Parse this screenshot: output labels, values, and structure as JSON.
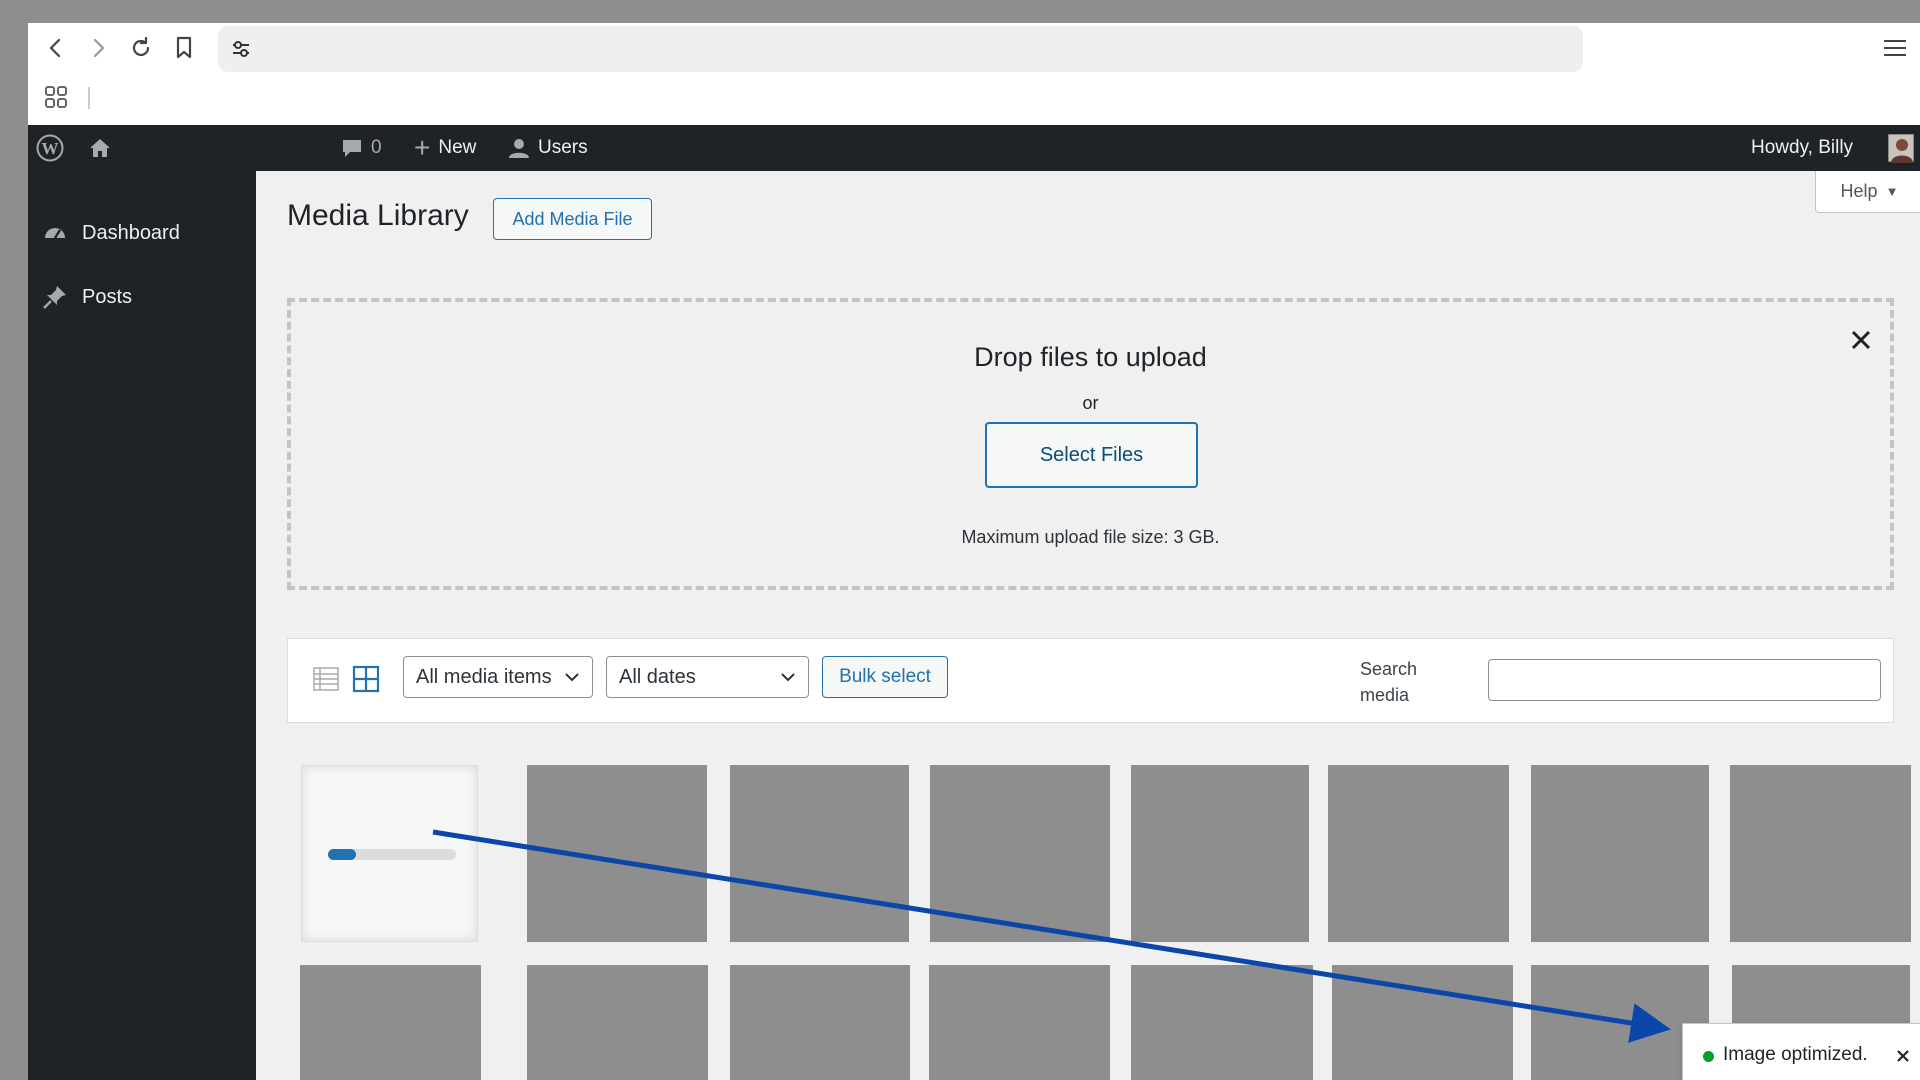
{
  "browser": {
    "url": "",
    "icons": [
      "back-icon",
      "forward-icon",
      "reload-icon",
      "bookmark-icon",
      "site-settings-icon",
      "menu-icon",
      "apps-grid-icon"
    ]
  },
  "adminbar": {
    "comments_count": "0",
    "new_label": "New",
    "users_label": "Users",
    "howdy": "Howdy, Billy"
  },
  "sidebar": {
    "items": [
      {
        "label": "Dashboard",
        "icon": "dashboard-icon"
      },
      {
        "label": "Posts",
        "icon": "pin-icon"
      }
    ]
  },
  "page": {
    "title": "Media Library",
    "add_button": "Add Media File",
    "help": "Help"
  },
  "uploader": {
    "heading": "Drop files to upload",
    "or": "or",
    "select_button": "Select Files",
    "max_size": "Maximum upload file size: 3 GB."
  },
  "toolbar": {
    "type_filter": "All media items",
    "date_filter": "All dates",
    "bulk_select": "Bulk select",
    "search_label_1": "Search",
    "search_label_2": "media",
    "search_value": ""
  },
  "notice": {
    "text": "Image optimized."
  },
  "colors": {
    "accent": "#2271b1",
    "admin_dark": "#1d2327",
    "success": "#00a32a",
    "annotation_arrow": "#0b47a8"
  }
}
